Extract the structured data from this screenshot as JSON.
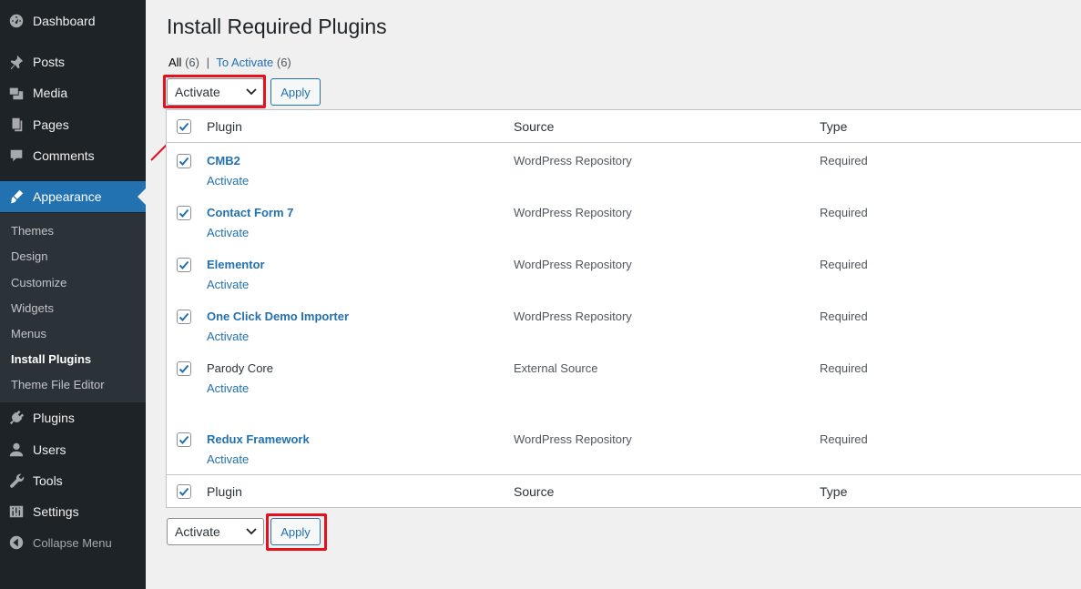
{
  "sidebar": {
    "items": [
      {
        "label": "Dashboard",
        "icon": "dashboard-icon"
      },
      {
        "label": "Posts",
        "icon": "pin-icon"
      },
      {
        "label": "Media",
        "icon": "media-icon"
      },
      {
        "label": "Pages",
        "icon": "pages-icon"
      },
      {
        "label": "Comments",
        "icon": "comment-icon"
      },
      {
        "label": "Appearance",
        "icon": "brush-icon"
      },
      {
        "label": "Plugins",
        "icon": "plug-icon"
      },
      {
        "label": "Users",
        "icon": "user-icon"
      },
      {
        "label": "Tools",
        "icon": "wrench-icon"
      },
      {
        "label": "Settings",
        "icon": "sliders-icon"
      }
    ],
    "submenu": [
      "Themes",
      "Design",
      "Customize",
      "Widgets",
      "Menus",
      "Install Plugins",
      "Theme File Editor"
    ],
    "collapse_label": "Collapse Menu"
  },
  "page": {
    "title": "Install Required Plugins",
    "filters": {
      "all_label": "All",
      "all_count": "(6)",
      "separator": "|",
      "activate_label": "To Activate",
      "activate_count": "(6)"
    },
    "bulk_action": {
      "selected": "Activate",
      "apply_label": "Apply"
    }
  },
  "table": {
    "columns": [
      "Plugin",
      "Source",
      "Type"
    ],
    "rows": [
      {
        "name": "CMB2",
        "action": "Activate",
        "source": "WordPress Repository",
        "type": "Required",
        "checked": true
      },
      {
        "name": "Contact Form 7",
        "action": "Activate",
        "source": "WordPress Repository",
        "type": "Required",
        "checked": true
      },
      {
        "name": "Elementor",
        "action": "Activate",
        "source": "WordPress Repository",
        "type": "Required",
        "checked": true
      },
      {
        "name": "One Click Demo Importer",
        "action": "Activate",
        "source": "WordPress Repository",
        "type": "Required",
        "checked": true
      },
      {
        "name": "Parody Core",
        "action": "Activate",
        "source": "External Source",
        "type": "Required",
        "checked": true
      },
      {
        "name": "Redux Framework",
        "action": "Activate",
        "source": "WordPress Repository",
        "type": "Required",
        "checked": true
      }
    ]
  },
  "colors": {
    "accent": "#2271b1",
    "sidebar_bg": "#1d2327",
    "highlight": "#e3121d"
  }
}
